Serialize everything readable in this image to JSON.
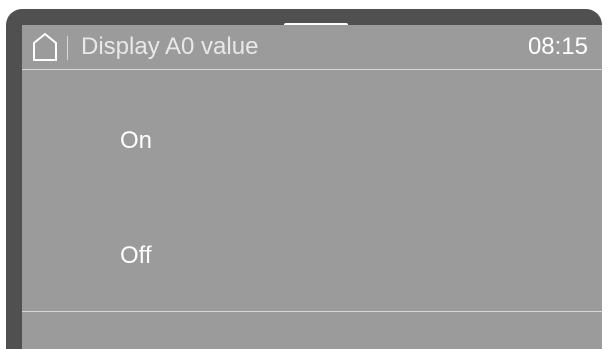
{
  "header": {
    "home_icon": "home-icon",
    "title": "Display A0 value",
    "clock": "08:15"
  },
  "options": [
    {
      "label": "On"
    },
    {
      "label": "Off"
    }
  ],
  "colors": {
    "bezel": "#505050",
    "screen": "#9b9b9c",
    "text": "#ffffff",
    "rule": "#d6d6d6"
  }
}
